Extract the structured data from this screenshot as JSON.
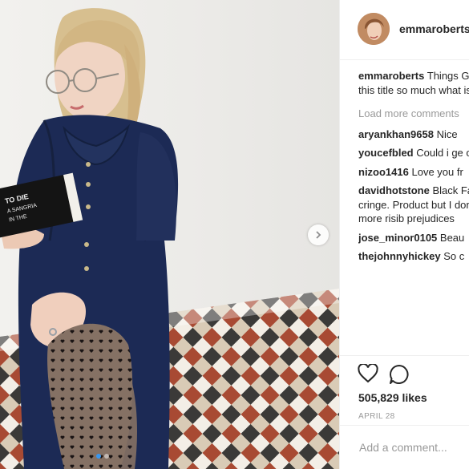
{
  "post": {
    "username": "emmaroberts",
    "caption_prefix": "Things",
    "caption_rest": "Goth In The Country & love this title so much what is everybody else",
    "load_more": "Load more comments",
    "likes": "505,829 likes",
    "date": "APRIL 28",
    "add_comment_placeholder": "Add a comment..."
  },
  "comments": [
    {
      "user": "aryankhan9658",
      "text": "Nice"
    },
    {
      "user": "youcefbled",
      "text": "Could i ge or"
    },
    {
      "user": "nizoo1416",
      "text": "Love you fr"
    },
    {
      "user": "davidhotstone",
      "text": "Black Falcon. Mostly it's gre really cringe. Product but I don't think you ca some of her more risib prejudices"
    },
    {
      "user": "jose_minor0105",
      "text": "Beau"
    },
    {
      "user": "thejohnnyhickey",
      "text": "So c"
    }
  ],
  "book": {
    "cover_text": "TO DIE A SANGRIA IN THE"
  },
  "colors": {
    "dress": "#1c2a55",
    "link_blue": "#3897f0",
    "muted": "#999999"
  },
  "icons": {
    "heart": "heart-icon",
    "comment": "comment-bubble-icon",
    "next": "chevron-right-icon"
  }
}
